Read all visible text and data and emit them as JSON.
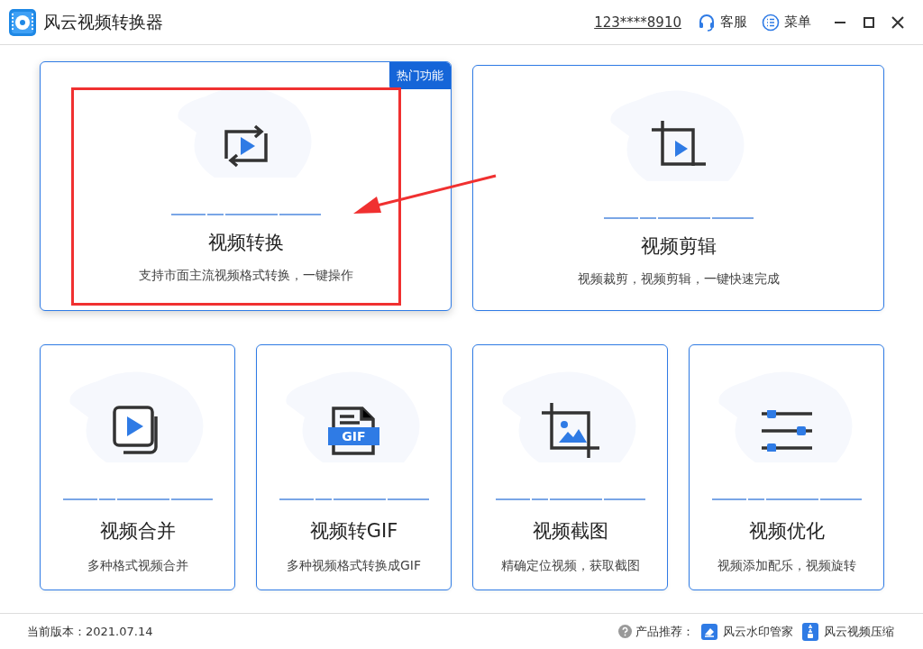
{
  "window": {
    "title": "风云视频转换器"
  },
  "header": {
    "account": "123****8910",
    "service": "客服",
    "menu": "菜单"
  },
  "cards": [
    {
      "kind": "convert",
      "title": "视频转换",
      "description": "支持市面主流视频格式转换，一键操作",
      "badge": "热门功能",
      "selected": true
    },
    {
      "kind": "edit",
      "title": "视频剪辑",
      "description": "视频裁剪，视频剪辑，一键快速完成",
      "selected": false
    },
    {
      "kind": "merge",
      "title": "视频合并",
      "description": "多种格式视频合并",
      "selected": false
    },
    {
      "kind": "gif",
      "title": "视频转GIF",
      "description": "多种视频格式转换成GIF",
      "icon_label": "GIF",
      "selected": false
    },
    {
      "kind": "screenshot",
      "title": "视频截图",
      "description": "精确定位视频，获取截图",
      "selected": false
    },
    {
      "kind": "optimize",
      "title": "视频优化",
      "description": "视频添加配乐，视频旋转",
      "selected": false
    }
  ],
  "footer": {
    "version": "当前版本：2021.07.14",
    "recommend_label": "产品推荐：",
    "products": [
      {
        "kind": "watermark",
        "name": "风云水印管家"
      },
      {
        "kind": "compress",
        "name": "风云视频压缩"
      }
    ]
  }
}
